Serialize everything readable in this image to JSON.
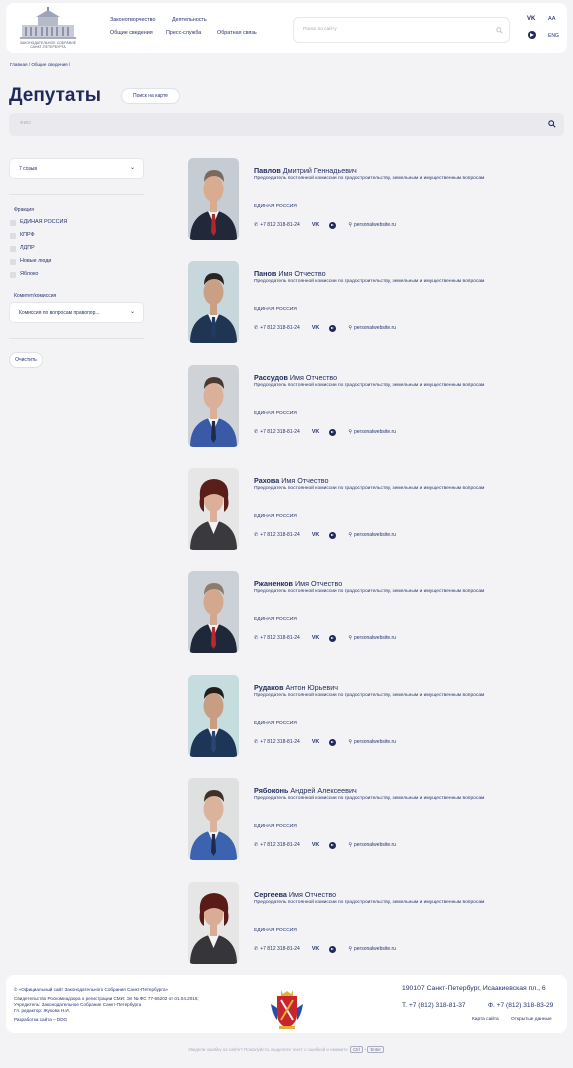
{
  "header": {
    "logo_text": "ЗАКОНОДАТЕЛЬНОЕ СОБРАНИЕ САНКТ-ПЕТЕРБУРГА",
    "nav_row1": [
      "Законотворчество",
      "Деятельность"
    ],
    "nav_row2": [
      "Общие сведения",
      "Пресс-служба",
      "Обратная связь"
    ],
    "search_placeholder": "Поиск по сайту",
    "vk": "VK",
    "font_size": "AA",
    "lang": "ENG"
  },
  "breadcrumb": "Главная / Общие сведения /",
  "page_title": "Депутаты",
  "map_button": "Поиск на карте",
  "fio_placeholder": "ФИО",
  "sidebar": {
    "convocation": "7 созыв",
    "faction_label": "Фракция",
    "factions": [
      "ЕДИНАЯ РОССИЯ",
      "КПРФ",
      "ЛДПР",
      "Новые люди",
      "Яблоко"
    ],
    "committee_label": "Комитет/комиссия",
    "committee_value": "Комиссия по вопросам правопор...",
    "clear": "Очистить"
  },
  "deputies": [
    {
      "last": "Павлов",
      "first": "Дмитрий Геннадьевич",
      "position": "Председатель постоянной комиссии по градостроительству, земельным и имущественным вопросам",
      "faction": "ЕДИНАЯ РОССИЯ",
      "phone": "+7 812 318-81-24",
      "vk": "VK",
      "site": "personalwebsite.ru"
    },
    {
      "last": "Панов",
      "first": "Имя Отчество",
      "position": "Председатель постоянной комиссии по градостроительству, земельным и имущественным вопросам",
      "faction": "ЕДИНАЯ РОССИЯ",
      "phone": "+7 812 318-81-24",
      "vk": "VK",
      "site": "personalwebsite.ru"
    },
    {
      "last": "Рассудов",
      "first": "Имя Отчество",
      "position": "Председатель постоянной комиссии по градостроительству, земельным и имущественным вопросам",
      "faction": "ЕДИНАЯ РОССИЯ",
      "phone": "+7 812 318-81-24",
      "vk": "VK",
      "site": "personalwebsite.ru"
    },
    {
      "last": "Рахова",
      "first": "Имя Отчество",
      "position": "Председатель постоянной комиссии по градостроительству, земельным и имущественным вопросам",
      "faction": "ЕДИНАЯ РОССИЯ",
      "phone": "+7 812 318-81-24",
      "vk": "VK",
      "site": "personalwebsite.ru"
    },
    {
      "last": "Ржаненков",
      "first": "Имя Отчество",
      "position": "Председатель постоянной комиссии по градостроительству, земельным и имущественным вопросам",
      "faction": "ЕДИНАЯ РОССИЯ",
      "phone": "+7 812 318-81-24",
      "vk": "VK",
      "site": "personalwebsite.ru"
    },
    {
      "last": "Рудаков",
      "first": "Антон Юрьевич",
      "position": "Председатель постоянной комиссии по градостроительству, земельным и имущественным вопросам",
      "faction": "ЕДИНАЯ РОССИЯ",
      "phone": "+7 812 318-81-24",
      "vk": "VK",
      "site": "personalwebsite.ru"
    },
    {
      "last": "Рябоконь",
      "first": "Андрей Алексеевич",
      "position": "Председатель постоянной комиссии по градостроительству, земельным и имущественным вопросам",
      "faction": "ЕДИНАЯ РОССИЯ",
      "phone": "+7 812 318-81-24",
      "vk": "VK",
      "site": "personalwebsite.ru"
    },
    {
      "last": "Сергеева",
      "first": "Имя Отчество",
      "position": "Председатель постоянной комиссии по градостроительству, земельным и имущественным вопросам",
      "faction": "ЕДИНАЯ РОССИЯ",
      "phone": "+7 812 318-81-24",
      "vk": "VK",
      "site": "personalwebsite.ru"
    }
  ],
  "footer": {
    "left": [
      "© «Официальный сайт Законодательного Собрания Санкт-Петербурга»",
      "Свидетельство Роскомнадзора о регистрации СМИ: Эл № ФС 77-65202 от 01.04.2016;",
      "Учредитель: Законодательное Собрание Санкт-Петербурга",
      "Гл. редактор: Жукова Н.И.",
      "Разработка сайта – DDG"
    ],
    "address": "190107 Санкт-Петербург, Исаакиевская пл., 6",
    "phone": "Т. +7 (812) 318-81-37",
    "fax": "Ф. +7 (812) 318-83-29",
    "site_map": "Карта сайта",
    "open_data": "Открытые данные"
  },
  "bottom_note": {
    "text": "Увидели ошибку на сайте? Пожалуйста, выделите текст с ошибкой и нажмите",
    "key1": "Ctrl",
    "plus": "+",
    "key2": "Enter"
  }
}
